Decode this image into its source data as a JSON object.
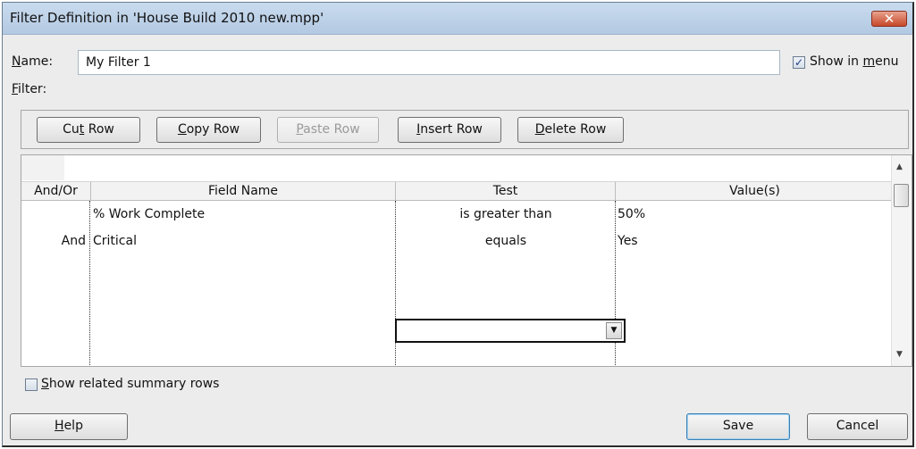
{
  "window": {
    "title": "Filter Definition in 'House Build 2010 new.mpp'",
    "close_glyph": "✕"
  },
  "name": {
    "label_key": "N",
    "label_rest": "ame:",
    "value": "My Filter 1"
  },
  "show_in_menu": {
    "checked": true,
    "label_pre": "Show in ",
    "label_key": "m",
    "label_post": "enu"
  },
  "filter_label": {
    "key": "F",
    "rest": "ilter:"
  },
  "toolbar": {
    "cut": {
      "pre": "Cu",
      "key": "t",
      "post": " Row"
    },
    "copy": {
      "pre": "",
      "key": "C",
      "post": "opy Row"
    },
    "paste": {
      "pre": "",
      "key": "P",
      "post": "aste Row",
      "disabled": true
    },
    "insert": {
      "pre": "",
      "key": "I",
      "post": "nsert Row"
    },
    "delete": {
      "pre": "",
      "key": "D",
      "post": "elete Row"
    }
  },
  "grid": {
    "columns": [
      "And/Or",
      "Field Name",
      "Test",
      "Value(s)"
    ],
    "rows": [
      {
        "and_or": "",
        "field": "% Work Complete",
        "test": "is greater than",
        "value": "50%"
      },
      {
        "and_or": "And",
        "field": "Critical",
        "test": "equals",
        "value": "Yes"
      }
    ]
  },
  "summary_rows": {
    "checked": false,
    "key": "S",
    "rest": "how related summary rows"
  },
  "footer": {
    "help": {
      "key": "H",
      "rest": "elp"
    },
    "save": "Save",
    "cancel": "Cancel"
  }
}
